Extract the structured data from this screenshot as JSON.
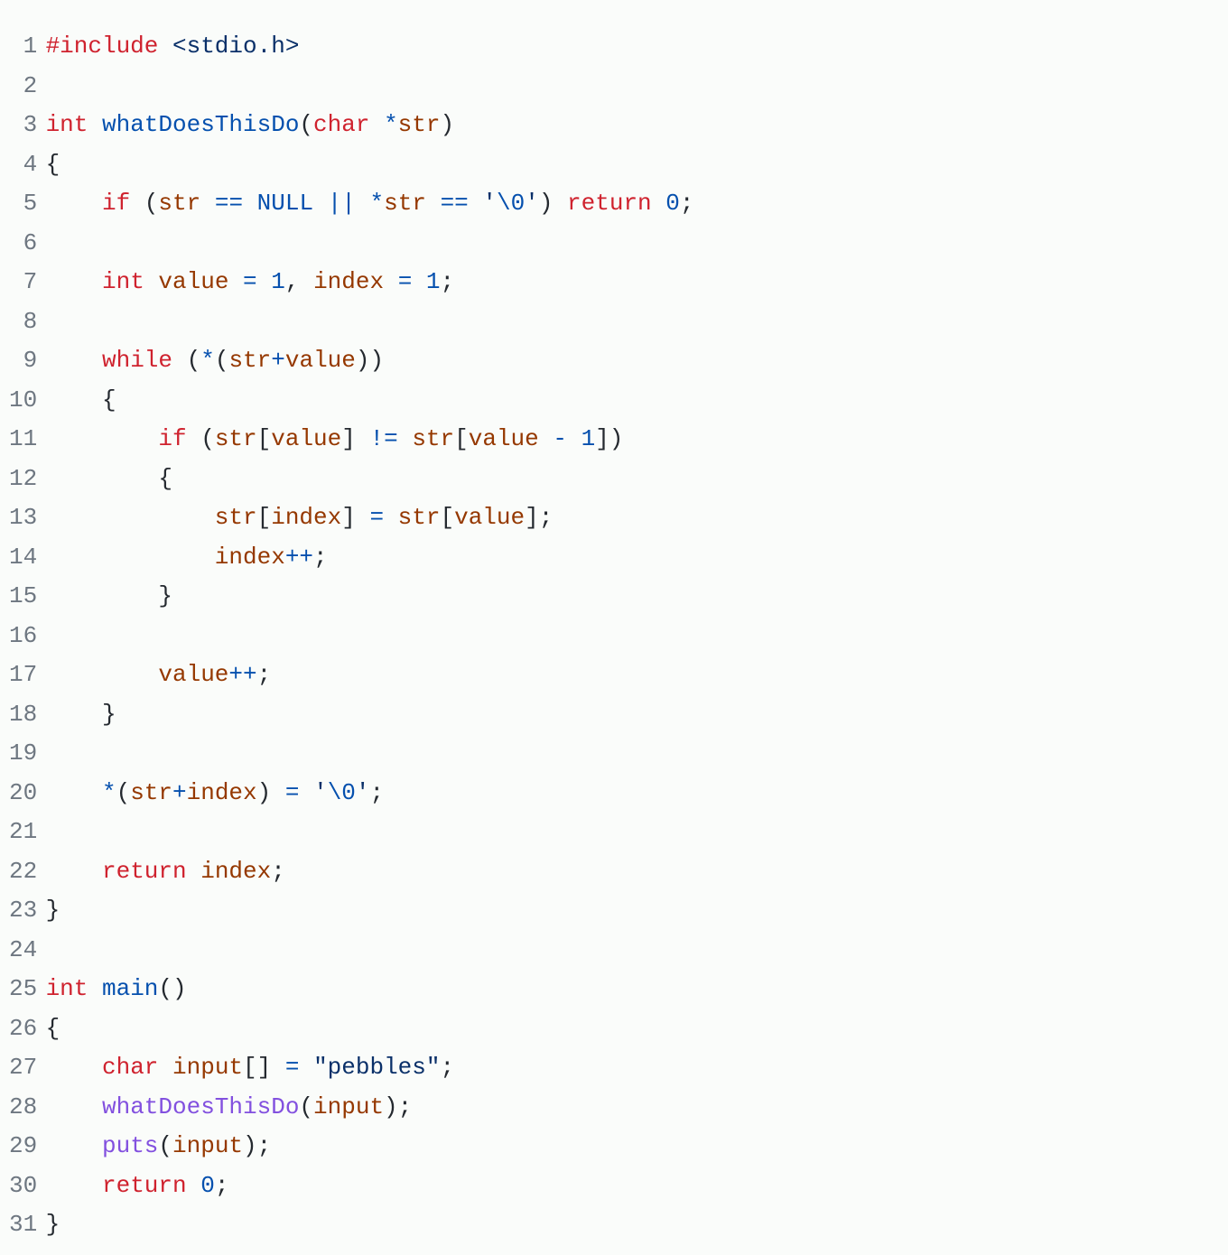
{
  "language": "c",
  "lines": [
    {
      "n": "1",
      "tokens": [
        {
          "cls": "pp",
          "t": "#include"
        },
        {
          "cls": "pun",
          "t": " "
        },
        {
          "cls": "hdr",
          "t": "<stdio.h>"
        }
      ]
    },
    {
      "n": "2",
      "tokens": []
    },
    {
      "n": "3",
      "tokens": [
        {
          "cls": "ty",
          "t": "int"
        },
        {
          "cls": "pun",
          "t": " "
        },
        {
          "cls": "fnb",
          "t": "whatDoesThisDo"
        },
        {
          "cls": "pun",
          "t": "("
        },
        {
          "cls": "ty",
          "t": "char"
        },
        {
          "cls": "pun",
          "t": " "
        },
        {
          "cls": "op",
          "t": "*"
        },
        {
          "cls": "var",
          "t": "str"
        },
        {
          "cls": "pun",
          "t": ")"
        }
      ]
    },
    {
      "n": "4",
      "tokens": [
        {
          "cls": "pun",
          "t": "{"
        }
      ]
    },
    {
      "n": "5",
      "tokens": [
        {
          "cls": "pun",
          "t": "    "
        },
        {
          "cls": "kw",
          "t": "if"
        },
        {
          "cls": "pun",
          "t": " ("
        },
        {
          "cls": "var",
          "t": "str"
        },
        {
          "cls": "pun",
          "t": " "
        },
        {
          "cls": "op",
          "t": "=="
        },
        {
          "cls": "pun",
          "t": " "
        },
        {
          "cls": "cnst",
          "t": "NULL"
        },
        {
          "cls": "pun",
          "t": " "
        },
        {
          "cls": "op",
          "t": "||"
        },
        {
          "cls": "pun",
          "t": " "
        },
        {
          "cls": "op",
          "t": "*"
        },
        {
          "cls": "var",
          "t": "str"
        },
        {
          "cls": "pun",
          "t": " "
        },
        {
          "cls": "op",
          "t": "=="
        },
        {
          "cls": "pun",
          "t": " "
        },
        {
          "cls": "str",
          "t": "'"
        },
        {
          "cls": "esc",
          "t": "\\0"
        },
        {
          "cls": "str",
          "t": "'"
        },
        {
          "cls": "pun",
          "t": ") "
        },
        {
          "cls": "kw",
          "t": "return"
        },
        {
          "cls": "pun",
          "t": " "
        },
        {
          "cls": "num",
          "t": "0"
        },
        {
          "cls": "pun",
          "t": ";"
        }
      ]
    },
    {
      "n": "6",
      "tokens": []
    },
    {
      "n": "7",
      "tokens": [
        {
          "cls": "pun",
          "t": "    "
        },
        {
          "cls": "ty",
          "t": "int"
        },
        {
          "cls": "pun",
          "t": " "
        },
        {
          "cls": "var",
          "t": "value"
        },
        {
          "cls": "pun",
          "t": " "
        },
        {
          "cls": "op",
          "t": "="
        },
        {
          "cls": "pun",
          "t": " "
        },
        {
          "cls": "num",
          "t": "1"
        },
        {
          "cls": "pun",
          "t": ", "
        },
        {
          "cls": "var",
          "t": "index"
        },
        {
          "cls": "pun",
          "t": " "
        },
        {
          "cls": "op",
          "t": "="
        },
        {
          "cls": "pun",
          "t": " "
        },
        {
          "cls": "num",
          "t": "1"
        },
        {
          "cls": "pun",
          "t": ";"
        }
      ]
    },
    {
      "n": "8",
      "tokens": []
    },
    {
      "n": "9",
      "tokens": [
        {
          "cls": "pun",
          "t": "    "
        },
        {
          "cls": "kw",
          "t": "while"
        },
        {
          "cls": "pun",
          "t": " ("
        },
        {
          "cls": "op",
          "t": "*"
        },
        {
          "cls": "pun",
          "t": "("
        },
        {
          "cls": "var",
          "t": "str"
        },
        {
          "cls": "op",
          "t": "+"
        },
        {
          "cls": "var",
          "t": "value"
        },
        {
          "cls": "pun",
          "t": "))"
        }
      ]
    },
    {
      "n": "10",
      "tokens": [
        {
          "cls": "pun",
          "t": "    {"
        }
      ]
    },
    {
      "n": "11",
      "tokens": [
        {
          "cls": "pun",
          "t": "        "
        },
        {
          "cls": "kw",
          "t": "if"
        },
        {
          "cls": "pun",
          "t": " ("
        },
        {
          "cls": "var",
          "t": "str"
        },
        {
          "cls": "pun",
          "t": "["
        },
        {
          "cls": "var",
          "t": "value"
        },
        {
          "cls": "pun",
          "t": "] "
        },
        {
          "cls": "op",
          "t": "!="
        },
        {
          "cls": "pun",
          "t": " "
        },
        {
          "cls": "var",
          "t": "str"
        },
        {
          "cls": "pun",
          "t": "["
        },
        {
          "cls": "var",
          "t": "value"
        },
        {
          "cls": "pun",
          "t": " "
        },
        {
          "cls": "op",
          "t": "-"
        },
        {
          "cls": "pun",
          "t": " "
        },
        {
          "cls": "num",
          "t": "1"
        },
        {
          "cls": "pun",
          "t": "])"
        }
      ]
    },
    {
      "n": "12",
      "tokens": [
        {
          "cls": "pun",
          "t": "        {"
        }
      ]
    },
    {
      "n": "13",
      "tokens": [
        {
          "cls": "pun",
          "t": "            "
        },
        {
          "cls": "var",
          "t": "str"
        },
        {
          "cls": "pun",
          "t": "["
        },
        {
          "cls": "var",
          "t": "index"
        },
        {
          "cls": "pun",
          "t": "] "
        },
        {
          "cls": "op",
          "t": "="
        },
        {
          "cls": "pun",
          "t": " "
        },
        {
          "cls": "var",
          "t": "str"
        },
        {
          "cls": "pun",
          "t": "["
        },
        {
          "cls": "var",
          "t": "value"
        },
        {
          "cls": "pun",
          "t": "];"
        }
      ]
    },
    {
      "n": "14",
      "tokens": [
        {
          "cls": "pun",
          "t": "            "
        },
        {
          "cls": "var",
          "t": "index"
        },
        {
          "cls": "op",
          "t": "++"
        },
        {
          "cls": "pun",
          "t": ";"
        }
      ]
    },
    {
      "n": "15",
      "tokens": [
        {
          "cls": "pun",
          "t": "        }"
        }
      ]
    },
    {
      "n": "16",
      "tokens": []
    },
    {
      "n": "17",
      "tokens": [
        {
          "cls": "pun",
          "t": "        "
        },
        {
          "cls": "var",
          "t": "value"
        },
        {
          "cls": "op",
          "t": "++"
        },
        {
          "cls": "pun",
          "t": ";"
        }
      ]
    },
    {
      "n": "18",
      "tokens": [
        {
          "cls": "pun",
          "t": "    }"
        }
      ]
    },
    {
      "n": "19",
      "tokens": []
    },
    {
      "n": "20",
      "tokens": [
        {
          "cls": "pun",
          "t": "    "
        },
        {
          "cls": "op",
          "t": "*"
        },
        {
          "cls": "pun",
          "t": "("
        },
        {
          "cls": "var",
          "t": "str"
        },
        {
          "cls": "op",
          "t": "+"
        },
        {
          "cls": "var",
          "t": "index"
        },
        {
          "cls": "pun",
          "t": ") "
        },
        {
          "cls": "op",
          "t": "="
        },
        {
          "cls": "pun",
          "t": " "
        },
        {
          "cls": "str",
          "t": "'"
        },
        {
          "cls": "esc",
          "t": "\\0"
        },
        {
          "cls": "str",
          "t": "'"
        },
        {
          "cls": "pun",
          "t": ";"
        }
      ]
    },
    {
      "n": "21",
      "tokens": []
    },
    {
      "n": "22",
      "tokens": [
        {
          "cls": "pun",
          "t": "    "
        },
        {
          "cls": "kw",
          "t": "return"
        },
        {
          "cls": "pun",
          "t": " "
        },
        {
          "cls": "var",
          "t": "index"
        },
        {
          "cls": "pun",
          "t": ";"
        }
      ]
    },
    {
      "n": "23",
      "tokens": [
        {
          "cls": "pun",
          "t": "}"
        }
      ]
    },
    {
      "n": "24",
      "tokens": []
    },
    {
      "n": "25",
      "tokens": [
        {
          "cls": "ty",
          "t": "int"
        },
        {
          "cls": "pun",
          "t": " "
        },
        {
          "cls": "fnb",
          "t": "main"
        },
        {
          "cls": "pun",
          "t": "()"
        }
      ]
    },
    {
      "n": "26",
      "tokens": [
        {
          "cls": "pun",
          "t": "{"
        }
      ]
    },
    {
      "n": "27",
      "tokens": [
        {
          "cls": "pun",
          "t": "    "
        },
        {
          "cls": "ty",
          "t": "char"
        },
        {
          "cls": "pun",
          "t": " "
        },
        {
          "cls": "var",
          "t": "input"
        },
        {
          "cls": "pun",
          "t": "[] "
        },
        {
          "cls": "op",
          "t": "="
        },
        {
          "cls": "pun",
          "t": " "
        },
        {
          "cls": "str",
          "t": "\"pebbles\""
        },
        {
          "cls": "pun",
          "t": ";"
        }
      ]
    },
    {
      "n": "28",
      "tokens": [
        {
          "cls": "pun",
          "t": "    "
        },
        {
          "cls": "fn",
          "t": "whatDoesThisDo"
        },
        {
          "cls": "pun",
          "t": "("
        },
        {
          "cls": "var",
          "t": "input"
        },
        {
          "cls": "pun",
          "t": ");"
        }
      ]
    },
    {
      "n": "29",
      "tokens": [
        {
          "cls": "pun",
          "t": "    "
        },
        {
          "cls": "fn",
          "t": "puts"
        },
        {
          "cls": "pun",
          "t": "("
        },
        {
          "cls": "var",
          "t": "input"
        },
        {
          "cls": "pun",
          "t": ");"
        }
      ]
    },
    {
      "n": "30",
      "tokens": [
        {
          "cls": "pun",
          "t": "    "
        },
        {
          "cls": "kw",
          "t": "return"
        },
        {
          "cls": "pun",
          "t": " "
        },
        {
          "cls": "num",
          "t": "0"
        },
        {
          "cls": "pun",
          "t": ";"
        }
      ]
    },
    {
      "n": "31",
      "tokens": [
        {
          "cls": "pun",
          "t": "}"
        }
      ]
    }
  ]
}
